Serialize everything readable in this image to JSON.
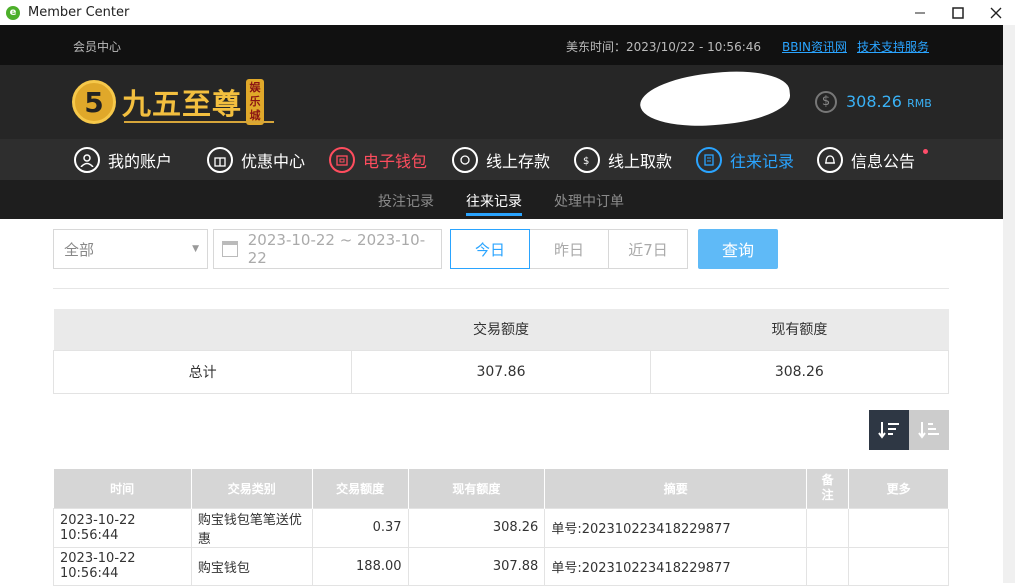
{
  "window": {
    "title": "Member Center"
  },
  "topbar": {
    "section": "会员中心",
    "time_label": "美东时间：2023/10/22 - 10:56:46",
    "links": [
      "BBIN资讯网",
      "技术支持服务"
    ]
  },
  "header": {
    "logo_text": "九五至尊",
    "logo_badge": "娱乐城",
    "balance": "308.26",
    "currency": "RMB"
  },
  "nav": {
    "items": [
      {
        "label": "我的账户",
        "icon": "user-icon"
      },
      {
        "label": "优惠中心",
        "icon": "gift-icon"
      },
      {
        "label": "电子钱包",
        "icon": "wallet-icon"
      },
      {
        "label": "线上存款",
        "icon": "deposit-icon"
      },
      {
        "label": "线上取款",
        "icon": "withdraw-icon"
      },
      {
        "label": "往来记录",
        "icon": "record-icon"
      },
      {
        "label": "信息公告",
        "icon": "bell-icon"
      }
    ]
  },
  "subnav": {
    "items": [
      "投注记录",
      "往来记录",
      "处理中订单"
    ]
  },
  "filters": {
    "type_value": "全部",
    "date_range": "2023-10-22 ~ 2023-10-22",
    "quick": [
      "今日",
      "昨日",
      "近7日"
    ],
    "query": "查询"
  },
  "summary": {
    "headers": [
      "",
      "交易额度",
      "现有额度"
    ],
    "row": [
      "总计",
      "307.86",
      "308.26"
    ]
  },
  "records": {
    "headers": [
      "时间",
      "交易类别",
      "交易额度",
      "现有额度",
      "摘要",
      "备注",
      "更多"
    ],
    "rows": [
      [
        "2023-10-22 10:56:44",
        "购宝钱包笔笔送优惠",
        "0.37",
        "308.26",
        "单号:202310223418229877",
        "",
        ""
      ],
      [
        "2023-10-22 10:56:44",
        "购宝钱包",
        "188.00",
        "307.88",
        "单号:202310223418229877",
        "",
        ""
      ]
    ]
  },
  "colors": {
    "accent": "#2aa4ff",
    "highlight": "#ff4d5e",
    "gold": "#f3bf3f"
  }
}
